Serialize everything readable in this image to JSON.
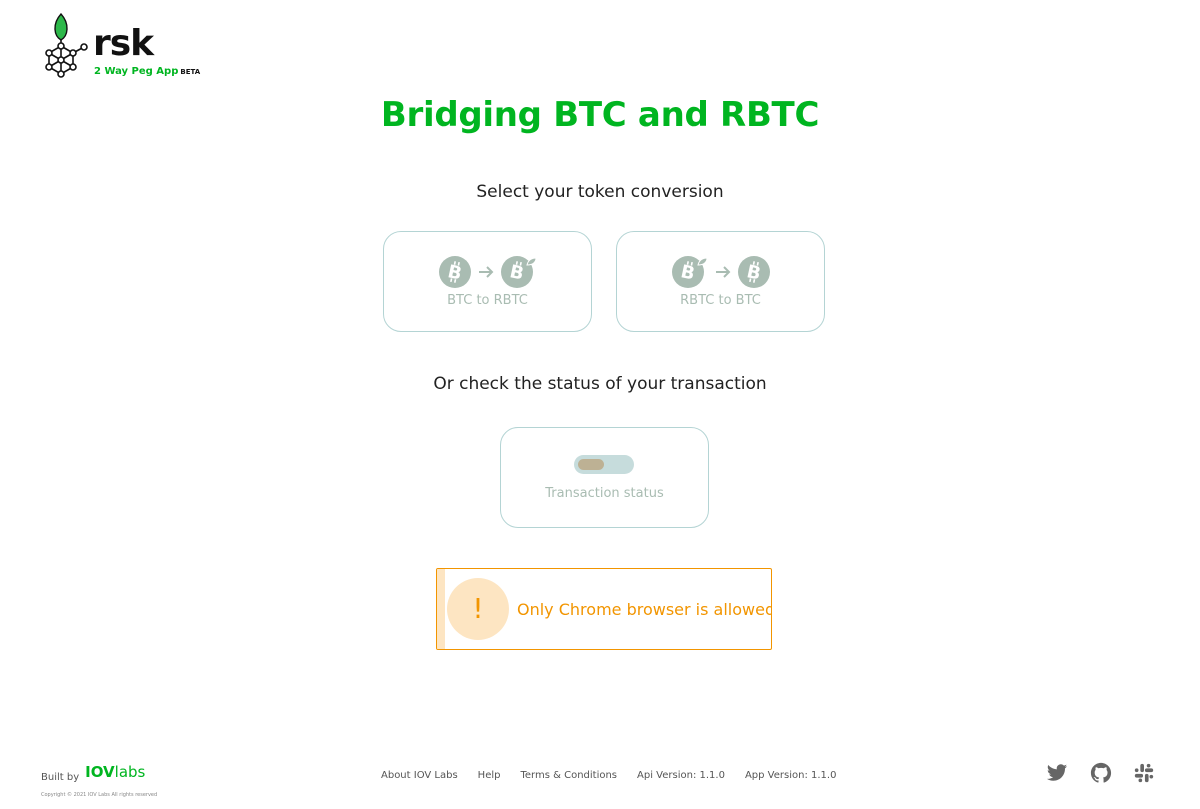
{
  "header": {
    "logo_text": "rsk",
    "logo_subtitle": "2 Way Peg App",
    "logo_badge": "BETA"
  },
  "main": {
    "title": "Bridging BTC and RBTC",
    "select_prompt": "Select your token conversion",
    "options": [
      {
        "label": "BTC to RBTC",
        "from_icon": "bitcoin-icon",
        "to_icon": "rbtc-icon"
      },
      {
        "label": "RBTC to BTC",
        "from_icon": "rbtc-icon",
        "to_icon": "bitcoin-icon"
      }
    ],
    "status_prompt": "Or check the status of your transaction",
    "status_card_label": "Transaction status"
  },
  "alert": {
    "icon": "!",
    "message": "Only Chrome browser is allowed"
  },
  "footer": {
    "built_by": "Built by",
    "brand_bold": "IOV",
    "brand_rest": "labs",
    "copyright": "Copyright © 2021 IOV Labs All rights reserved",
    "links": [
      "About IOV Labs",
      "Help",
      "Terms & Conditions"
    ],
    "api_version": "Api Version: 1.1.0",
    "app_version": "App Version: 1.1.0",
    "social": [
      "twitter-icon",
      "github-icon",
      "slack-icon"
    ]
  },
  "colors": {
    "brand_green": "#00b520",
    "warning_orange": "#f29500",
    "card_border": "#b4d4d4",
    "icon_muted": "#a9bcb2"
  }
}
